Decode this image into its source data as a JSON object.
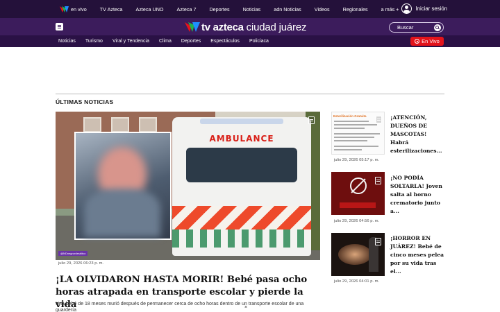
{
  "topbar": {
    "items": [
      {
        "label": "en vivo",
        "icon": "tv-azteca-logo-icon"
      },
      {
        "label": "TV Azteca"
      },
      {
        "label": "Azteca UNO"
      },
      {
        "label": "Azteca 7"
      },
      {
        "label": "Deportes"
      },
      {
        "label": "Noticias"
      },
      {
        "label": "adn Noticias"
      },
      {
        "label": "Videos"
      },
      {
        "label": "Regionales"
      },
      {
        "label": "a más +"
      }
    ],
    "login_label": "Iniciar sesión"
  },
  "brand": {
    "logo_tv": "tv azteca",
    "logo_city": "ciudad juárez",
    "search_placeholder": "Buscar"
  },
  "section_nav": {
    "items": [
      "Noticias",
      "Turismo",
      "Viral y Tendencia",
      "Clima",
      "Deportes",
      "Espectáculos",
      "Policiaca"
    ],
    "live_label": "En Vivo"
  },
  "section_title": "ÚLTIMAS NOTICIAS",
  "main_article": {
    "image_text": "AMBULANCE",
    "credit": "@NDnegrurdesbitco",
    "date": "julio 29, 2026 06:23 p. m.",
    "headline": "¡LA OLVIDARON HASTA MORIR! Bebé pasa ocho horas atrapada en transporte escolar y pierde la vida",
    "summary": "Una bebé de 18 meses murió después de permanecer cerca de ocho horas dentro de un transporte escolar de una guardería"
  },
  "side_articles": [
    {
      "image_text": "Esterilización Gratuita",
      "date": "julio 29, 2026 05:17 p. m.",
      "title": "¡ATENCIÓN, DUEÑOS DE MASCOTAS! Habrá esterilizaciones..."
    },
    {
      "date": "julio 29, 2026 04:56 p. m.",
      "title": "¡NO PODÍA SOLTARLA! Joven salta al horno crematorio junto a..."
    },
    {
      "date": "julio 29, 2026 04:01 p. m.",
      "title": "¡HORROR EN JUÁREZ! Bebé de cinco meses pelea por su vida tras el..."
    }
  ],
  "close_label": "×",
  "colors": {
    "topbar_bg": "#24113a",
    "brandbar_bg": "#3c1c5c",
    "secnav_bg": "#2a1145",
    "live_red": "#e3131b"
  }
}
